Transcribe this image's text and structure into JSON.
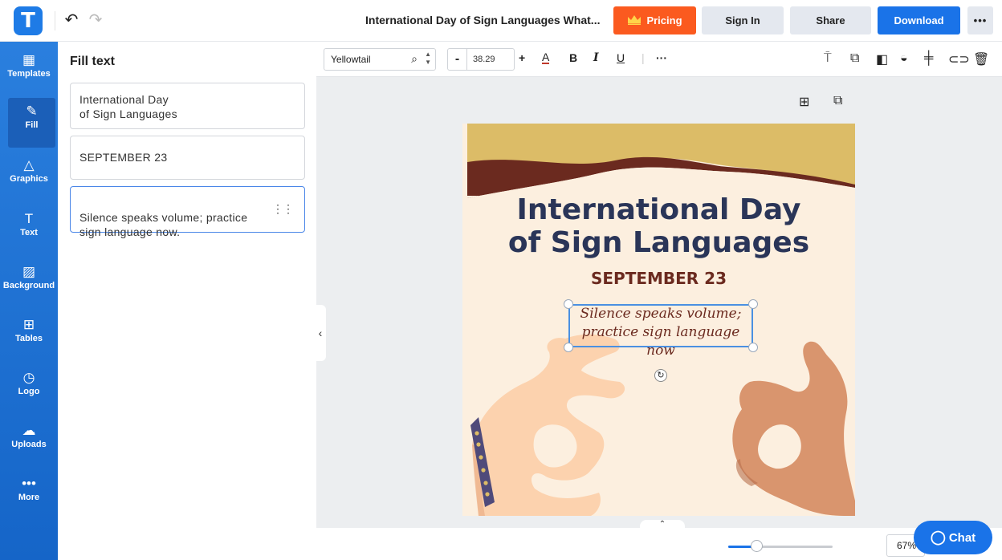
{
  "app": {
    "logo_letter": "T"
  },
  "header": {
    "undo_icon": "↶",
    "redo_icon": "↷",
    "doc_title": "International Day of Sign Languages What...",
    "pricing": "Pricing",
    "signin": "Sign In",
    "share": "Share",
    "download": "Download",
    "more": "•••"
  },
  "sidebar": {
    "items": [
      {
        "label": "Templates",
        "icon": "▦"
      },
      {
        "label": "Fill",
        "icon": "✎"
      },
      {
        "label": "Graphics",
        "icon": "△"
      },
      {
        "label": "Text",
        "icon": "T"
      },
      {
        "label": "Background",
        "icon": "▨"
      },
      {
        "label": "Tables",
        "icon": "⊞"
      },
      {
        "label": "Logo",
        "icon": "◷"
      },
      {
        "label": "Uploads",
        "icon": "☁"
      },
      {
        "label": "More",
        "icon": "•••"
      }
    ]
  },
  "fill_panel": {
    "title": "Fill text",
    "fields": [
      "International Day\nof Sign Languages",
      "SEPTEMBER 23",
      "Silence speaks volume; practice\nsign language now."
    ]
  },
  "toolbar": {
    "font": "Yellowtail",
    "size": "38.29",
    "minus": "-",
    "plus": "+"
  },
  "design": {
    "title_line1": "International Day",
    "title_line2": "of Sign Languages",
    "date": "SEPTEMBER 23",
    "quote": "Silence speaks volume;\npractice sign language now"
  },
  "footer": {
    "zoom": "67%",
    "zoom_level": 0.23,
    "chat": "Chat"
  },
  "colors": {
    "accent": "#1a73e8",
    "pricing": "#fb5a1f",
    "title": "#2a3558",
    "brown": "#6b2a1f",
    "gold": "#dcbc67",
    "skin_light": "#fcd2ae",
    "skin_dark": "#d9956e"
  }
}
